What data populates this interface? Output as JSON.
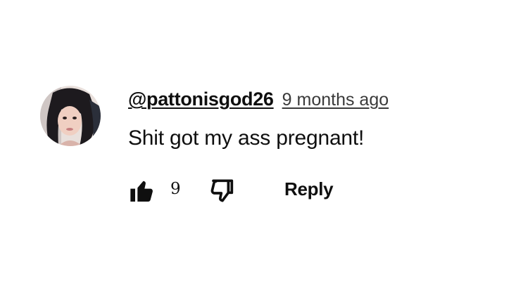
{
  "comment": {
    "author": "@pattonisgod26",
    "timestamp": "9 months ago",
    "text": "Shit got my ass pregnant!",
    "like_count": "9",
    "reply_label": "Reply"
  },
  "icons": {
    "like": "thumbs-up-icon",
    "dislike": "thumbs-down-icon"
  },
  "colors": {
    "text": "#0f0f0f",
    "secondary_text": "#3a3a3a",
    "background": "#ffffff"
  }
}
